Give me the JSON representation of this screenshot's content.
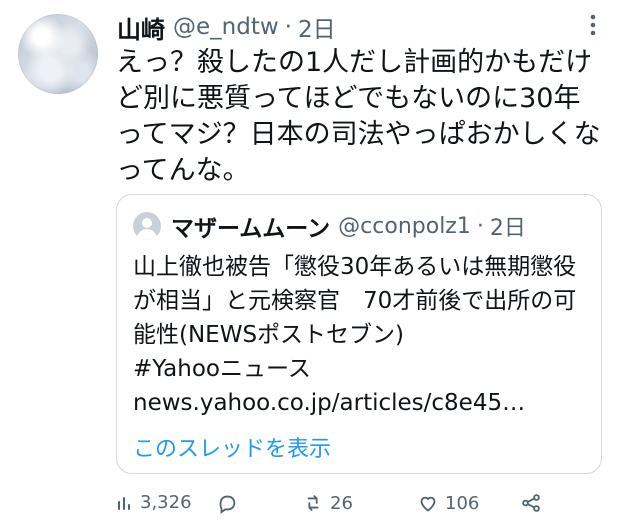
{
  "tweet": {
    "display_name": "山崎",
    "handle": "@e_ndtw",
    "separator": "·",
    "time": "2日",
    "text": "えっ？殺したの1人だし計画的かもだけど別に悪質ってほどでもないのに30年ってマジ？日本の司法やっぱおかしくなってんな。"
  },
  "quote": {
    "display_name": "マザームムーン",
    "handle": "@cconpolz1",
    "separator": "·",
    "time": "2日",
    "text": "山上徹也被告「懲役30年あるいは無期懲役が相当」と元検察官　70才前後で出所の可能性(NEWSポストセブン)\n#Yahooニュース\nnews.yahoo.co.jp/articles/c8e45…",
    "thread_link": "このスレッドを表示"
  },
  "actions": {
    "views": "3,326",
    "retweets": "26",
    "likes": "106"
  },
  "icons": {
    "more": "more-icon",
    "views": "views-icon",
    "reply": "reply-icon",
    "retweet": "retweet-icon",
    "like": "like-icon",
    "share": "share-icon"
  },
  "colors": {
    "text": "#0f1419",
    "muted": "#536471",
    "border": "#cfd9de",
    "link": "#1d9bf0"
  }
}
